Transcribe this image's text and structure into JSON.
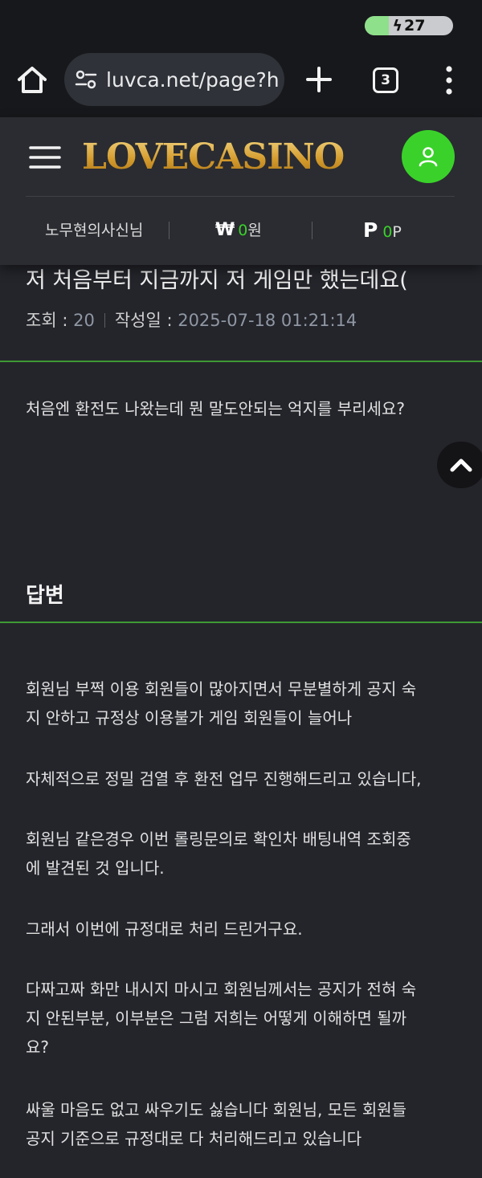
{
  "status_bar": {
    "battery_level": "27",
    "battery_fraction": 0.27
  },
  "browser": {
    "url": "luvca.net/page?h",
    "tab_count": "3"
  },
  "header": {
    "logo": "LOVECASINO",
    "username": "노무현의사신님",
    "won_sign": "₩",
    "won_amount": "0",
    "won_unit": "원",
    "point_sign": "P",
    "point_amount": "0",
    "point_unit": "P"
  },
  "post": {
    "title": "저 처음부터 지금까지 저 게임만 했는데요(",
    "views_label": "조회 : ",
    "views_value": "20",
    "date_label": "작성일 : ",
    "date_value": "2025-07-18 01:21:14",
    "body": "처음엔 환전도 나왔는데 뭔 말도안되는 억지를 부리세요?"
  },
  "answer": {
    "heading": "답변",
    "paragraphs": [
      [
        "회원님 부쩍 이용 회원들이 많아지면서 무분별하게 공지 숙",
        "지 안하고 규정상 이용불가 게임 회원들이 늘어나"
      ],
      [
        "자체적으로 정밀 검열 후 환전 업무 진행해드리고 있습니다,"
      ],
      [
        "회원님 같은경우 이번 롤링문의로 확인차 배팅내역 조회중",
        "에 발견된 것 입니다."
      ],
      [
        "그래서 이번에 규정대로 처리 드린거구요."
      ],
      [
        "다짜고짜 화만 내시지 마시고 회원님께서는 공지가 전혀 숙",
        "지 안된부분, 이부분은 그럼 저희는 어떻게 이해하면 될까",
        "요?"
      ],
      [
        "싸울 마음도 없고 싸우기도 싫습니다 회원님, 모든 회원들",
        "공지 기준으로 규정대로 다 처리해드리고 있습니다"
      ]
    ]
  },
  "colors": {
    "accent_green": "#3ad22a",
    "divider_green": "#3e9a33",
    "logo_gold": "#e3b347",
    "background": "#24252b"
  }
}
